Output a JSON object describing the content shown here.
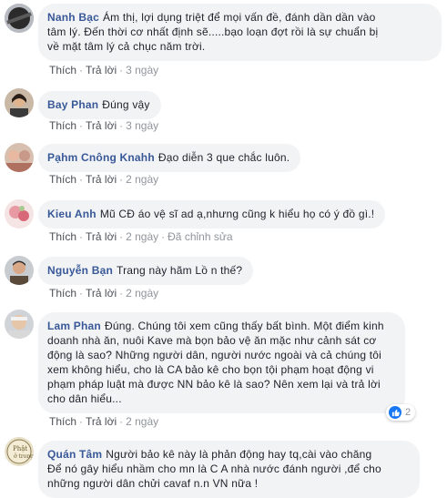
{
  "actions": {
    "like": "Thích",
    "reply": "Trả lời",
    "edited": "Đã chỉnh sửa",
    "separator": "·"
  },
  "colors": {
    "author": "#385898",
    "bubble": "#f2f3f5",
    "meta": "#90949c",
    "like": "#1877f2"
  },
  "comments": [
    {
      "author": "Nanh Bạc",
      "lines": [
        "Ám thị, lợi dụng triệt để mọi vấn đề, đánh dần dần vào",
        "tâm lý. Đến thời cơ nhất định sẽ.....bạo loạn đợt rồi là sự chuẩn bị",
        "về mặt tâm lý cả chục năm trời."
      ],
      "time": "3 ngày"
    },
    {
      "author": "Bay Phan",
      "lines": [
        "Đúng vậy"
      ],
      "time": "3 ngày"
    },
    {
      "author": "Pạhm Cnông Knahh",
      "lines": [
        "Đạo diễn 3 que chắc luôn."
      ],
      "time": "2 ngày"
    },
    {
      "author": "Kieu Anh",
      "lines": [
        "Mũ CĐ áo vệ sĩ ad ạ,nhưng cũng k hiểu họ có ý đồ gì.!"
      ],
      "time": "2 ngày"
    },
    {
      "author": "Nguyễn Bạn",
      "lines": [
        "Trang này hãm Lồ n thế?"
      ],
      "time": "2 ngày"
    },
    {
      "author": "Lam Phan",
      "lines": [
        "Đúng. Chúng tôi xem cũng thấy bất bình. Một điểm kinh",
        "doanh nhà ăn, nuôi Kave mà bọn bảo vệ ăn mặc như cảnh sát cơ",
        "động là sao? Những người dân, người nước ngoài và cả chúng tôi",
        "xem không hiểu, cho là CA bảo kê cho bọn tội phạm hoạt động vi",
        "phạm pháp luật mà được NN bảo kê là sao? Nên xem lại và trả lời",
        "cho dân hiểu..."
      ],
      "time": "2 ngày",
      "reactions": "2"
    },
    {
      "author": "Quán Tâm",
      "lines": [
        "Người bảo kê này là phản động hay tq,cài vào chăng",
        "Để nó gây hiểu nhầm cho mn là C A nhà nước đánh người ,để cho",
        "những người dân chửi cavaf n.n VN nữa !"
      ]
    }
  ]
}
